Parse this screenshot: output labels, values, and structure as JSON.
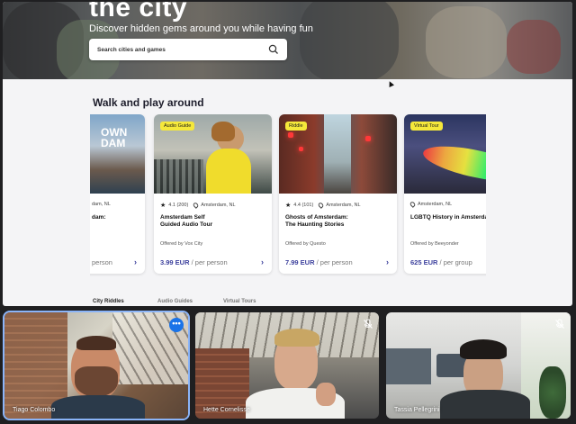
{
  "hero": {
    "title": "the city",
    "subtitle": "Discover hidden gems around you while having fun",
    "search_placeholder": "Search cities and games",
    "search_icon": "search-icon"
  },
  "section": {
    "title": "Walk and play around"
  },
  "cards": [
    {
      "badge": "",
      "image_text": "OWN\nDAM",
      "rating": "",
      "location": "dam, NL",
      "title": "dam:",
      "offered_by": "",
      "price": "",
      "price_unit": "person",
      "arrow": "›"
    },
    {
      "badge": "Audio Guide",
      "image_text": "",
      "rating": "4.1 (200)",
      "location": "Amsterdam, NL",
      "title": "Amsterdam Self\nGuided Audio Tour",
      "offered_by": "Offered by Vox City",
      "price": "3.99 EUR",
      "price_unit": "/ per person",
      "arrow": "›"
    },
    {
      "badge": "Riddle",
      "image_text": "",
      "rating": "4.4 (101)",
      "location": "Amsterdam, NL",
      "title": "Ghosts of Amsterdam:\nThe Haunting Stories",
      "offered_by": "Offered by Questo",
      "price": "7.99 EUR",
      "price_unit": "/ per person",
      "arrow": "›"
    },
    {
      "badge": "Virtual Tour",
      "image_text": "",
      "rating": "",
      "location": "Amsterdam, NL",
      "title": "LGBTQ History in Amsterda",
      "offered_by": "Offered by Beeyonder",
      "price": "625 EUR",
      "price_unit": "/ per group",
      "arrow": "›"
    }
  ],
  "tabs": [
    "City Riddles",
    "Audio Guides",
    "Virtual Tours"
  ],
  "participants": [
    {
      "name": "Tiago Colombo",
      "active": true,
      "more_label": "•••"
    },
    {
      "name": "Hette Cornelisse",
      "muted": true
    },
    {
      "name": "Tassia Pellegrini",
      "muted": true
    }
  ],
  "colors": {
    "accent": "#3b3f9c",
    "badge": "#f5e83a",
    "speaker_outline": "#8ab4f8"
  }
}
